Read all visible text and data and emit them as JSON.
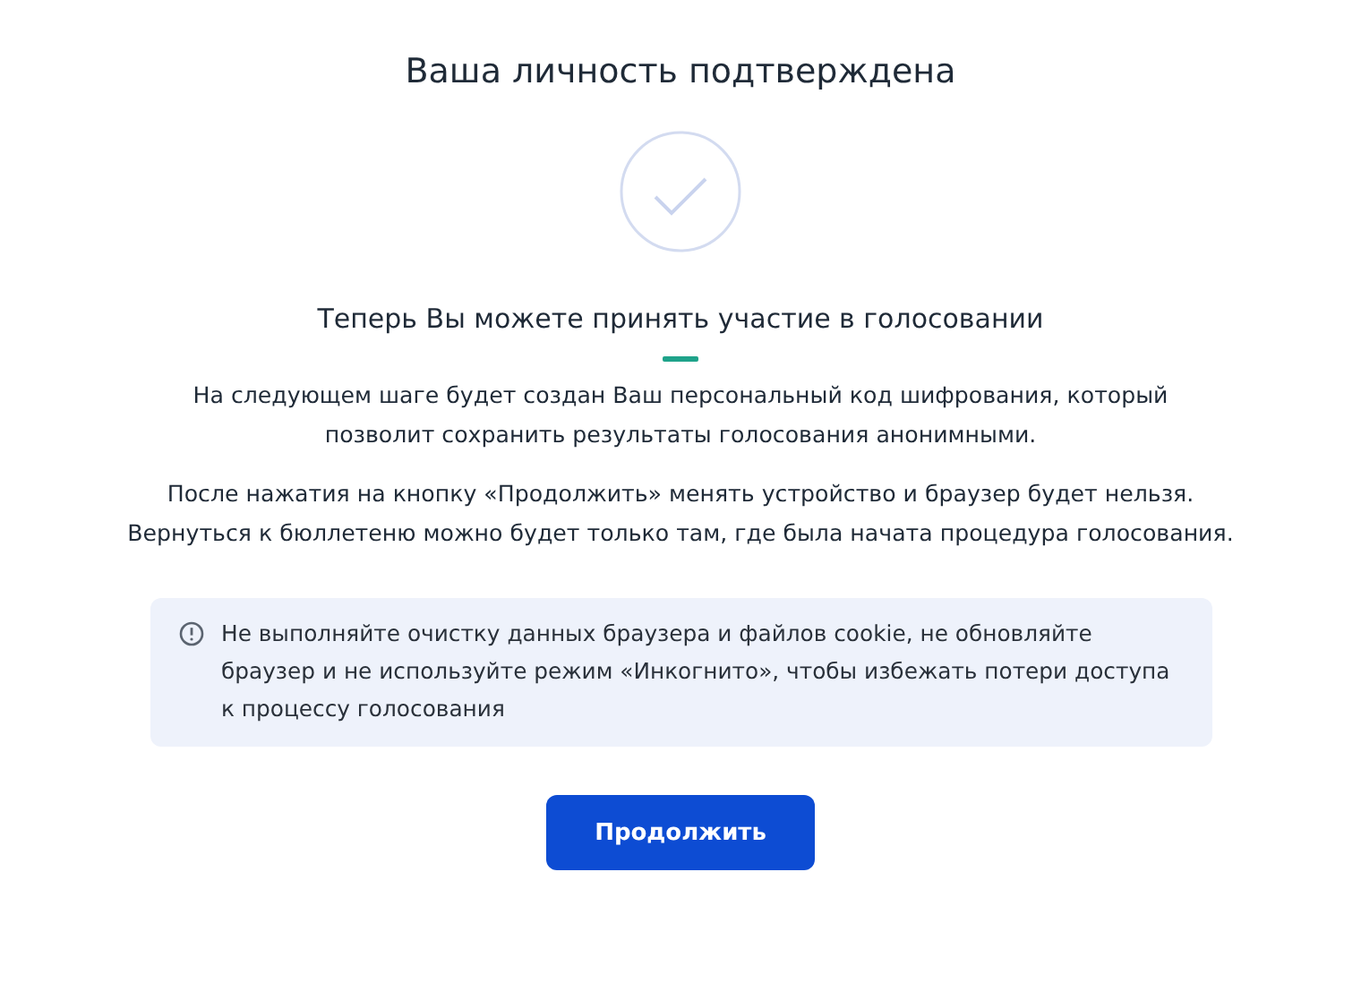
{
  "title": "Ваша личность подтверждена",
  "subtitle": "Теперь Вы можете принять участие в голосовании",
  "paragraphs": [
    "На следующем шаге будет создан Ваш персональный код шифрования, который позволит сохранить результаты голосования анонимными.",
    "После нажатия на кнопку «Продолжить» менять устройство и браузер будет нельзя. Вернуться к бюллетеню можно будет только там, где была начата процедура голосования."
  ],
  "notice": "Не выполняйте очистку данных браузера и файлов cookie, не обновляйте браузер и не используйте режим «Инкогнито», чтобы избежать потери доступа к процессу голосования",
  "button": "Продолжить"
}
